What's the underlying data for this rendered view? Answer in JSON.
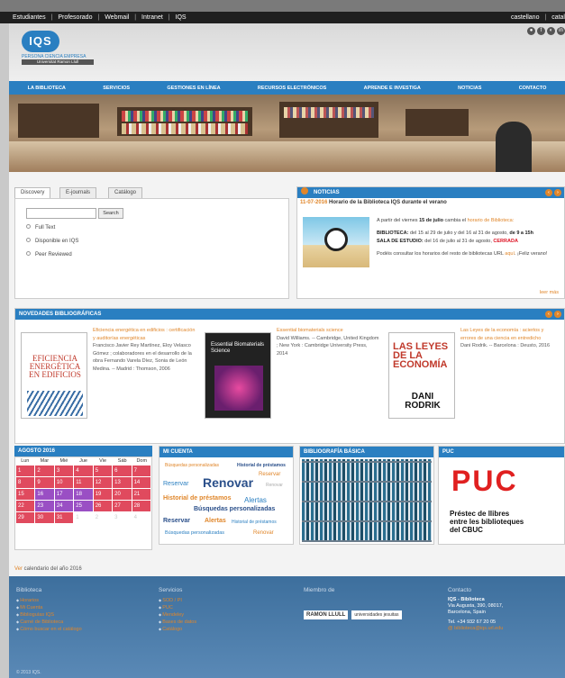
{
  "topbar": {
    "links": [
      "Estudiantes",
      "|",
      "Profesorado",
      "|",
      "Webmail",
      "|",
      "Intranet",
      "|",
      "IQS"
    ],
    "languages": [
      "castellano",
      "|",
      "catal"
    ]
  },
  "header": {
    "logo": "IQS",
    "tagline": "PERSONA CIENCIA EMPRESA",
    "university": "Universitat Ramon Llull"
  },
  "nav": [
    "LA BIBLIOTECA",
    "SERVICIOS",
    "GESTIONES EN LÍNEA",
    "RECURSOS ELECTRÓNICOS",
    "APRENDE E INVESTIGA",
    "NOTICIAS",
    "CONTACTO"
  ],
  "search": {
    "tabs": [
      "Discovery",
      "E-journals",
      "Catálogo"
    ],
    "button": "Search",
    "options": [
      "Full Text",
      "Disponible en IQS",
      "Peer Reviewed"
    ]
  },
  "noticias": {
    "title": "NOTICIAS",
    "date": "11-07-2016",
    "headline": "Horario de la Biblioteca IQS durante el verano",
    "p1a": "A partir del viernes ",
    "p1b": "15 de julio",
    "p1c": " cambia el ",
    "p1d": "horario de Biblioteca:",
    "p2a": "BIBLIOTECA:",
    "p2b": " del 15 al 29 de julio y del 16 al 31 de agosto, ",
    "p2c": "de 9 a 15h",
    "p3a": "SALA DE ESTUDIO:",
    "p3b": " del 16 de julio al 31 de agosto, ",
    "p3c": "CERRADA",
    "p4a": "Podéis consultar los horarios del resto de bibliotecas URL ",
    "p4b": "aquí",
    "p4c": ". ¡Feliz verano!",
    "more": "leer más"
  },
  "novedades": {
    "title": "NOVEDADES BIBLIOGRÁFICAS",
    "books": [
      {
        "cover_title": "EFICIENCIA ENERGÉTICA EN EDIFICIOS",
        "title": "Eficiencia energética en edificios : certificación y auditorías energéticas",
        "desc": "Francisco Javier Rey Martínez, Eloy Velasco Gómez ; colaboradores en el desarrollo de la obra Fernando Varela Díez, Sonia de León Medina. -- Madrid : Thomson, 2006"
      },
      {
        "cover_title": "Essential Biomaterials Science",
        "title": "Essential biomaterials science",
        "desc": "David Williams. -- Cambridge, United Kingdom ; New York : Cambridge University Press, 2014"
      },
      {
        "cover_title": "LAS LEYES DE LA ECONOMÍA",
        "cover_author": "DANI RODRIK",
        "title": "Las Leyes de la economía : aciertos y errores de una ciencia en entredicho",
        "desc": "Dani Rodrik. -- Barcelona : Deusto, 2016"
      }
    ]
  },
  "agenda": {
    "title": "AGOSTO 2016",
    "days": [
      "Lun",
      "Mar",
      "Mié",
      "Jue",
      "Vie",
      "Sáb",
      "Dom"
    ],
    "cells": [
      "1",
      "2",
      "3",
      "4",
      "5",
      "6",
      "7",
      "8",
      "9",
      "10",
      "11",
      "12",
      "13",
      "14",
      "15",
      "16",
      "17",
      "18",
      "19",
      "20",
      "21",
      "22",
      "23",
      "24",
      "25",
      "26",
      "27",
      "28",
      "29",
      "30",
      "31",
      "1",
      "2",
      "3",
      "4"
    ],
    "link_a": "Ver",
    "link_b": " calendario del año 2016"
  },
  "micuenta": {
    "title": "MI CUENTA",
    "words": [
      "Búsquedas personalizadas",
      "Historial de préstamos",
      "Reservar",
      "Renovar",
      "Reservar",
      "Historial de préstamos",
      "Alertas",
      "Búsquedas personalizadas",
      "Reservar",
      "Alertas",
      "Historial de préstamos",
      "Búsquedas personalizadas",
      "Renovar",
      "Renovar"
    ]
  },
  "biblio": {
    "title": "BIBLIOGRAFÍA BÁSICA"
  },
  "puc": {
    "title": "PUC",
    "big": "PUC",
    "line1": "Préstec de llibres",
    "line2": "entre les biblioteques",
    "line3": "del CBUC"
  },
  "footer": {
    "col1": {
      "title": "Biblioteca",
      "items": [
        "Horarios",
        "Mi Cuenta",
        "Biblioguías IQS",
        "Carné de Biblioteca",
        "Cómo buscar en el catálogo"
      ]
    },
    "col2": {
      "title": "Servicios",
      "items": [
        "SOD / PI",
        "PUC",
        "Mendeley",
        "Bases de datos",
        "Catálogo"
      ]
    },
    "col3": {
      "title": "Miembro de",
      "logo1": "RAMON LLULL",
      "logo2": "universidades jesuitas"
    },
    "col4": {
      "title": "Contacto",
      "name": "IQS - Biblioteca",
      "address1": "Via Augusta, 390, 08017,",
      "address2": "Barcelona, Spain",
      "tel": "Tel. +34 932 67 20 05",
      "email": "@ biblioteca@iqs.url.edu"
    },
    "copyright": "© 2013 IQS."
  },
  "colors": {
    "primary": "#2a7fc1",
    "accent": "#e0862a",
    "calendar_red": "#e04a5e",
    "calendar_purple": "#9a4fc4"
  }
}
